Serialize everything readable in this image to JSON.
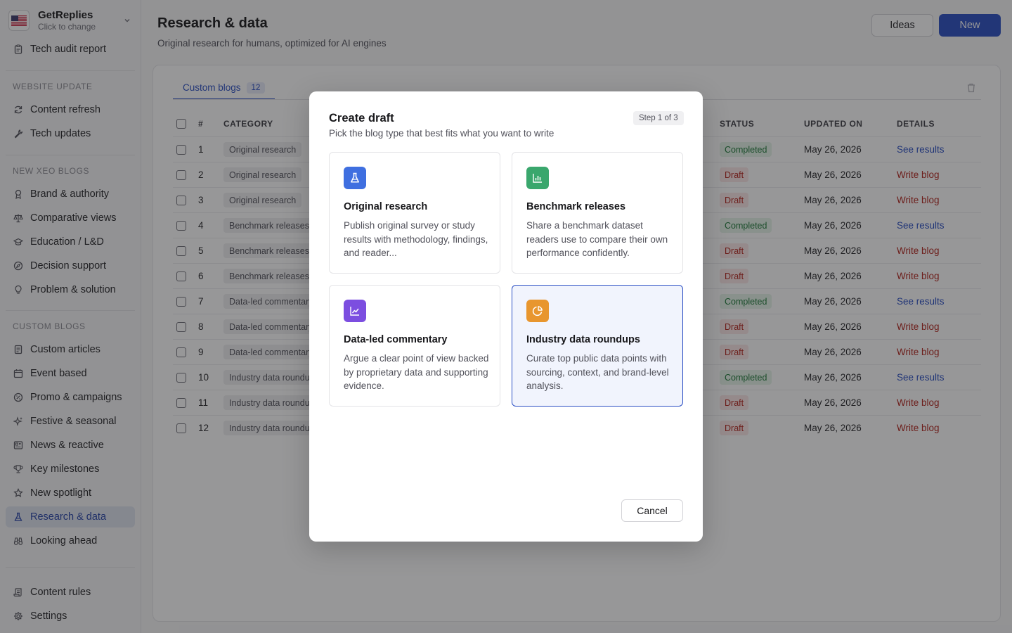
{
  "account": {
    "name": "GetReplies",
    "subtitle": "Click to change"
  },
  "sidebar": {
    "top_items": [
      {
        "label": "Tech audit report",
        "icon": "clipboard-icon"
      }
    ],
    "sections": [
      {
        "title": "WEBSITE UPDATE",
        "items": [
          {
            "label": "Content refresh",
            "icon": "refresh-icon"
          },
          {
            "label": "Tech updates",
            "icon": "wrench-icon"
          }
        ]
      },
      {
        "title": "NEW XEO BLOGS",
        "items": [
          {
            "label": "Brand & authority",
            "icon": "award-icon"
          },
          {
            "label": "Comparative views",
            "icon": "scale-icon"
          },
          {
            "label": "Education / L&D",
            "icon": "graduation-cap-icon"
          },
          {
            "label": "Decision support",
            "icon": "compass-icon"
          },
          {
            "label": "Problem & solution",
            "icon": "lightbulb-icon"
          }
        ]
      },
      {
        "title": "CUSTOM BLOGS",
        "items": [
          {
            "label": "Custom articles",
            "icon": "document-icon"
          },
          {
            "label": "Event based",
            "icon": "calendar-icon"
          },
          {
            "label": "Promo & campaigns",
            "icon": "percent-badge-icon"
          },
          {
            "label": "Festive & seasonal",
            "icon": "sparkles-icon"
          },
          {
            "label": "News & reactive",
            "icon": "newspaper-icon"
          },
          {
            "label": "Key milestones",
            "icon": "trophy-icon"
          },
          {
            "label": "New spotlight",
            "icon": "star-icon"
          },
          {
            "label": "Research & data",
            "icon": "flask-icon",
            "active": true
          },
          {
            "label": "Looking ahead",
            "icon": "binoculars-icon"
          }
        ]
      }
    ],
    "bottom_items": [
      {
        "label": "Content rules",
        "icon": "scroll-icon"
      },
      {
        "label": "Settings",
        "icon": "gear-icon"
      }
    ]
  },
  "header": {
    "title": "Research & data",
    "subtitle": "Original research for humans, optimized for AI engines",
    "ideas_label": "Ideas",
    "new_label": "New"
  },
  "tabs": [
    {
      "label": "Custom blogs",
      "count": "12"
    }
  ],
  "table": {
    "headers": {
      "num": "#",
      "category": "CATEGORY",
      "status": "STATUS",
      "updated": "UPDATED ON",
      "details": "DETAILS"
    },
    "rows": [
      {
        "num": "1",
        "category": "Original research",
        "status": "Completed",
        "updated": "May 26, 2026",
        "details": "See results"
      },
      {
        "num": "2",
        "category": "Original research",
        "status": "Draft",
        "updated": "May 26, 2026",
        "details": "Write blog"
      },
      {
        "num": "3",
        "category": "Original research",
        "status": "Draft",
        "updated": "May 26, 2026",
        "details": "Write blog"
      },
      {
        "num": "4",
        "category": "Benchmark releases",
        "status": "Completed",
        "updated": "May 26, 2026",
        "details": "See results"
      },
      {
        "num": "5",
        "category": "Benchmark releases",
        "status": "Draft",
        "updated": "May 26, 2026",
        "details": "Write blog"
      },
      {
        "num": "6",
        "category": "Benchmark releases",
        "status": "Draft",
        "updated": "May 26, 2026",
        "details": "Write blog"
      },
      {
        "num": "7",
        "category": "Data-led commentary",
        "status": "Completed",
        "updated": "May 26, 2026",
        "details": "See results"
      },
      {
        "num": "8",
        "category": "Data-led commentary",
        "status": "Draft",
        "updated": "May 26, 2026",
        "details": "Write blog"
      },
      {
        "num": "9",
        "category": "Data-led commentary",
        "status": "Draft",
        "updated": "May 26, 2026",
        "details": "Write blog"
      },
      {
        "num": "10",
        "category": "Industry data roundups",
        "status": "Completed",
        "updated": "May 26, 2026",
        "details": "See results"
      },
      {
        "num": "11",
        "category": "Industry data roundups",
        "status": "Draft",
        "updated": "May 26, 2026",
        "details": "Write blog"
      },
      {
        "num": "12",
        "category": "Industry data roundups",
        "status": "Draft",
        "updated": "May 26, 2026",
        "details": "Write blog"
      }
    ]
  },
  "modal": {
    "title": "Create draft",
    "subtitle": "Pick the blog type that best fits what you want to write",
    "step": "Step 1 of 3",
    "cancel_label": "Cancel",
    "options": [
      {
        "title": "Original research",
        "description": "Publish original survey or study results with methodology, findings, and reader...",
        "icon": "flask-icon",
        "color": "#3f6fe0",
        "selected": false
      },
      {
        "title": "Benchmark releases",
        "description": "Share a benchmark dataset readers use to compare their own performance confidently.",
        "icon": "bar-chart-icon",
        "color": "#3aa76d",
        "selected": false
      },
      {
        "title": "Data-led commentary",
        "description": "Argue a clear point of view backed by proprietary data and supporting evidence.",
        "icon": "line-chart-icon",
        "color": "#7c4ee0",
        "selected": false
      },
      {
        "title": "Industry data roundups",
        "description": "Curate top public data points with sourcing, context, and brand-level analysis.",
        "icon": "pie-chart-icon",
        "color": "#e8962e",
        "selected": true
      }
    ]
  },
  "colors": {
    "accent": "#2b4fc4",
    "completed": "#1f7a3a",
    "draft": "#b3261e"
  }
}
